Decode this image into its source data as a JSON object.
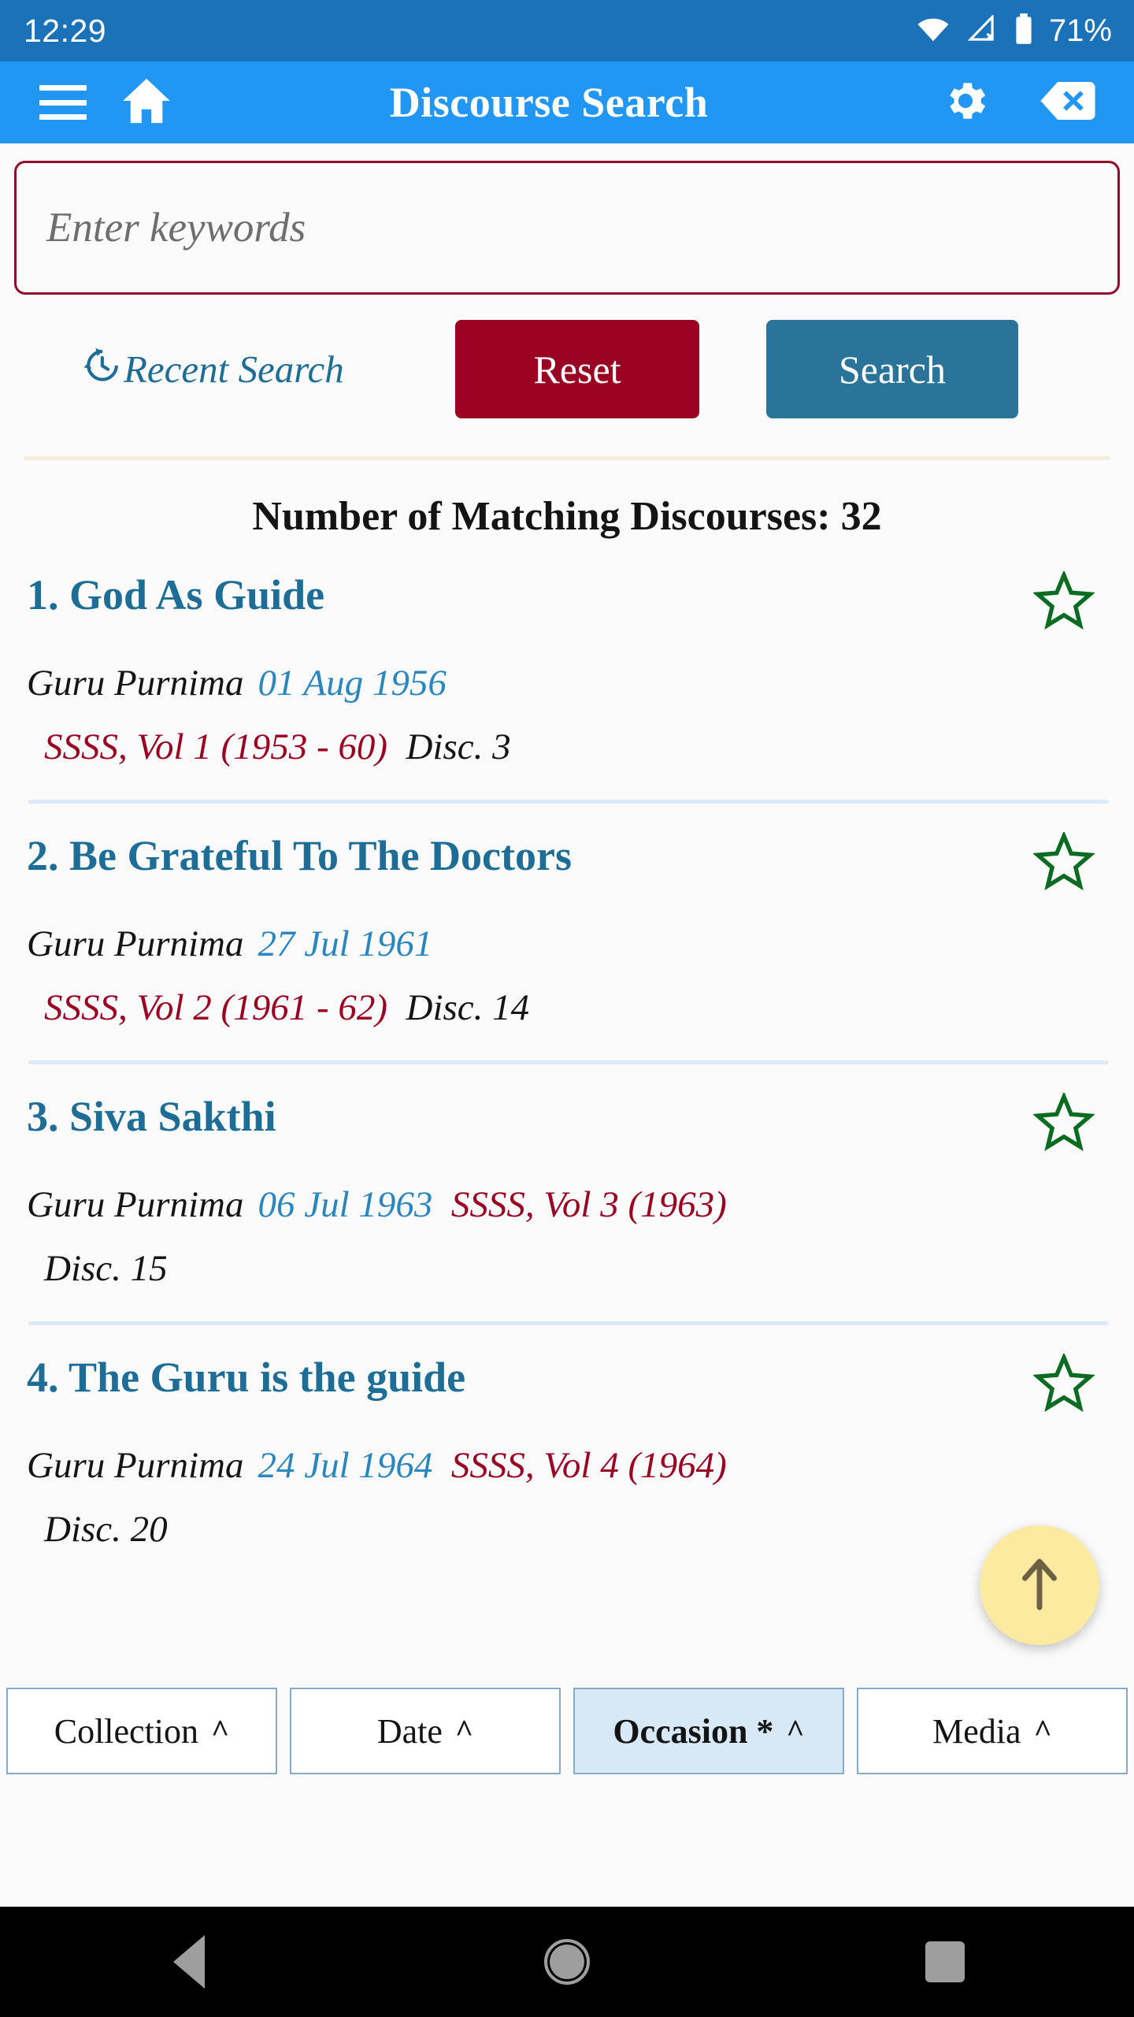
{
  "status_bar": {
    "time": "12:29",
    "battery_percent": "71%",
    "icons": [
      "wifi-icon",
      "cellular-no-signal-icon",
      "battery-icon"
    ]
  },
  "app_bar": {
    "title": "Discourse Search",
    "menu_icon": "hamburger-menu-icon",
    "home_icon": "home-icon",
    "settings_icon": "gear-icon",
    "close_icon": "backspace-close-icon"
  },
  "search": {
    "placeholder": "Enter keywords",
    "value": "",
    "recent_label": "Recent Search",
    "recent_icon": "history-clock-icon",
    "reset_label": "Reset",
    "search_label": "Search"
  },
  "results": {
    "count_label": "Number of Matching Discourses: 32",
    "count": 32,
    "items": [
      {
        "title": "1. God As Guide",
        "occasion": "Guru Purnima",
        "date": "01 Aug 1956",
        "collection": "SSSS, Vol 1 (1953 - 60)",
        "disc": "Disc. 3",
        "favorite_icon": "star-outline-icon",
        "wrapped": false
      },
      {
        "title": "2. Be Grateful To The Doctors",
        "occasion": "Guru Purnima",
        "date": "27 Jul 1961",
        "collection": "SSSS, Vol 2 (1961 - 62)",
        "disc": "Disc. 14",
        "favorite_icon": "star-outline-icon",
        "wrapped": false
      },
      {
        "title": "3. Siva Sakthi",
        "occasion": "Guru Purnima",
        "date": "06 Jul 1963",
        "collection": "SSSS, Vol 3 (1963)",
        "disc": "Disc. 15",
        "favorite_icon": "star-outline-icon",
        "wrapped": true
      },
      {
        "title": "4. The Guru is the guide",
        "occasion": "Guru Purnima",
        "date": "24 Jul 1964",
        "collection": "SSSS, Vol 4 (1964)",
        "disc": "Disc. 20",
        "favorite_icon": "star-outline-icon",
        "wrapped": true
      }
    ]
  },
  "scroll_top_button": {
    "icon": "arrow-up-icon"
  },
  "filter_bar": {
    "buttons": [
      {
        "label": "Collection",
        "active": false,
        "caret": "chevron-up-icon"
      },
      {
        "label": "Date",
        "active": false,
        "caret": "chevron-up-icon"
      },
      {
        "label": "Occasion *",
        "active": true,
        "caret": "chevron-up-icon"
      },
      {
        "label": "Media",
        "active": false,
        "caret": "chevron-up-icon"
      }
    ]
  },
  "nav_bar": {
    "back": "back-triangle-icon",
    "home": "home-circle-icon",
    "recents": "recents-square-icon"
  },
  "colors": {
    "status_bar": "#1b72b8",
    "app_bar": "#2196f3",
    "accent_teal": "#1d6d96",
    "accent_crimson": "#9a0022",
    "date_blue": "#2a86bd",
    "star_green": "#0a6b21",
    "fab_yellow": "#fbeaa0",
    "filter_active": "#d7e8f7"
  }
}
